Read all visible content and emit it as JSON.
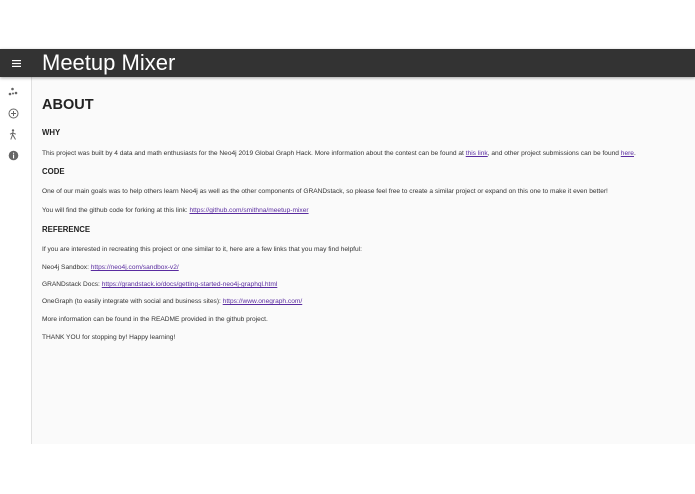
{
  "app": {
    "title": "Meetup Mixer",
    "menu_icon": "hamburger-menu-icon"
  },
  "drawer": {
    "items": [
      {
        "icon": "scatter-icon"
      },
      {
        "icon": "add-circle-icon"
      },
      {
        "icon": "person-walking-icon"
      },
      {
        "icon": "info-icon"
      }
    ]
  },
  "colors": {
    "appbar": "#333333",
    "page_background": "#fafafa",
    "link": "#5a2ca0"
  },
  "about": {
    "heading": "ABOUT",
    "why": {
      "heading": "WHY",
      "text_1": "This project was built by 4 data and math enthusiasts for the Neo4j 2019 Global Graph Hack. More information about the contest can be found at ",
      "link_1": "this link",
      "text_2": ", and other project submissions can be found ",
      "link_2": "here",
      "text_3": "."
    },
    "code": {
      "heading": "CODE",
      "paragraph_1": "One of our main goals was to help others learn Neo4j as well as the other components of GRANDstack, so please feel free to create a similar project or expand on this one to make it even better!",
      "paragraph_2_text": "You will find the github code for forking at this link: ",
      "paragraph_2_link": "https://github.com/smithna/meetup-mixer"
    },
    "reference": {
      "heading": "REFERENCE",
      "intro": "If you are interested in recreating this project or one similar to it, here are a few links that you may find helpful:",
      "links": [
        {
          "label": "Neo4j Sandbox: ",
          "url": "https://neo4j.com/sandbox-v2/"
        },
        {
          "label": "GRANDstack Docs: ",
          "url": "https://grandstack.io/docs/getting-started-neo4j-graphql.html"
        },
        {
          "label": "OneGraph (to easily integrate with social and business sites): ",
          "url": "https://www.onegraph.com/"
        }
      ],
      "more_info": "More information can be found in the README provided in the github project.",
      "thanks": "THANK YOU for stopping by! Happy learning!"
    }
  }
}
